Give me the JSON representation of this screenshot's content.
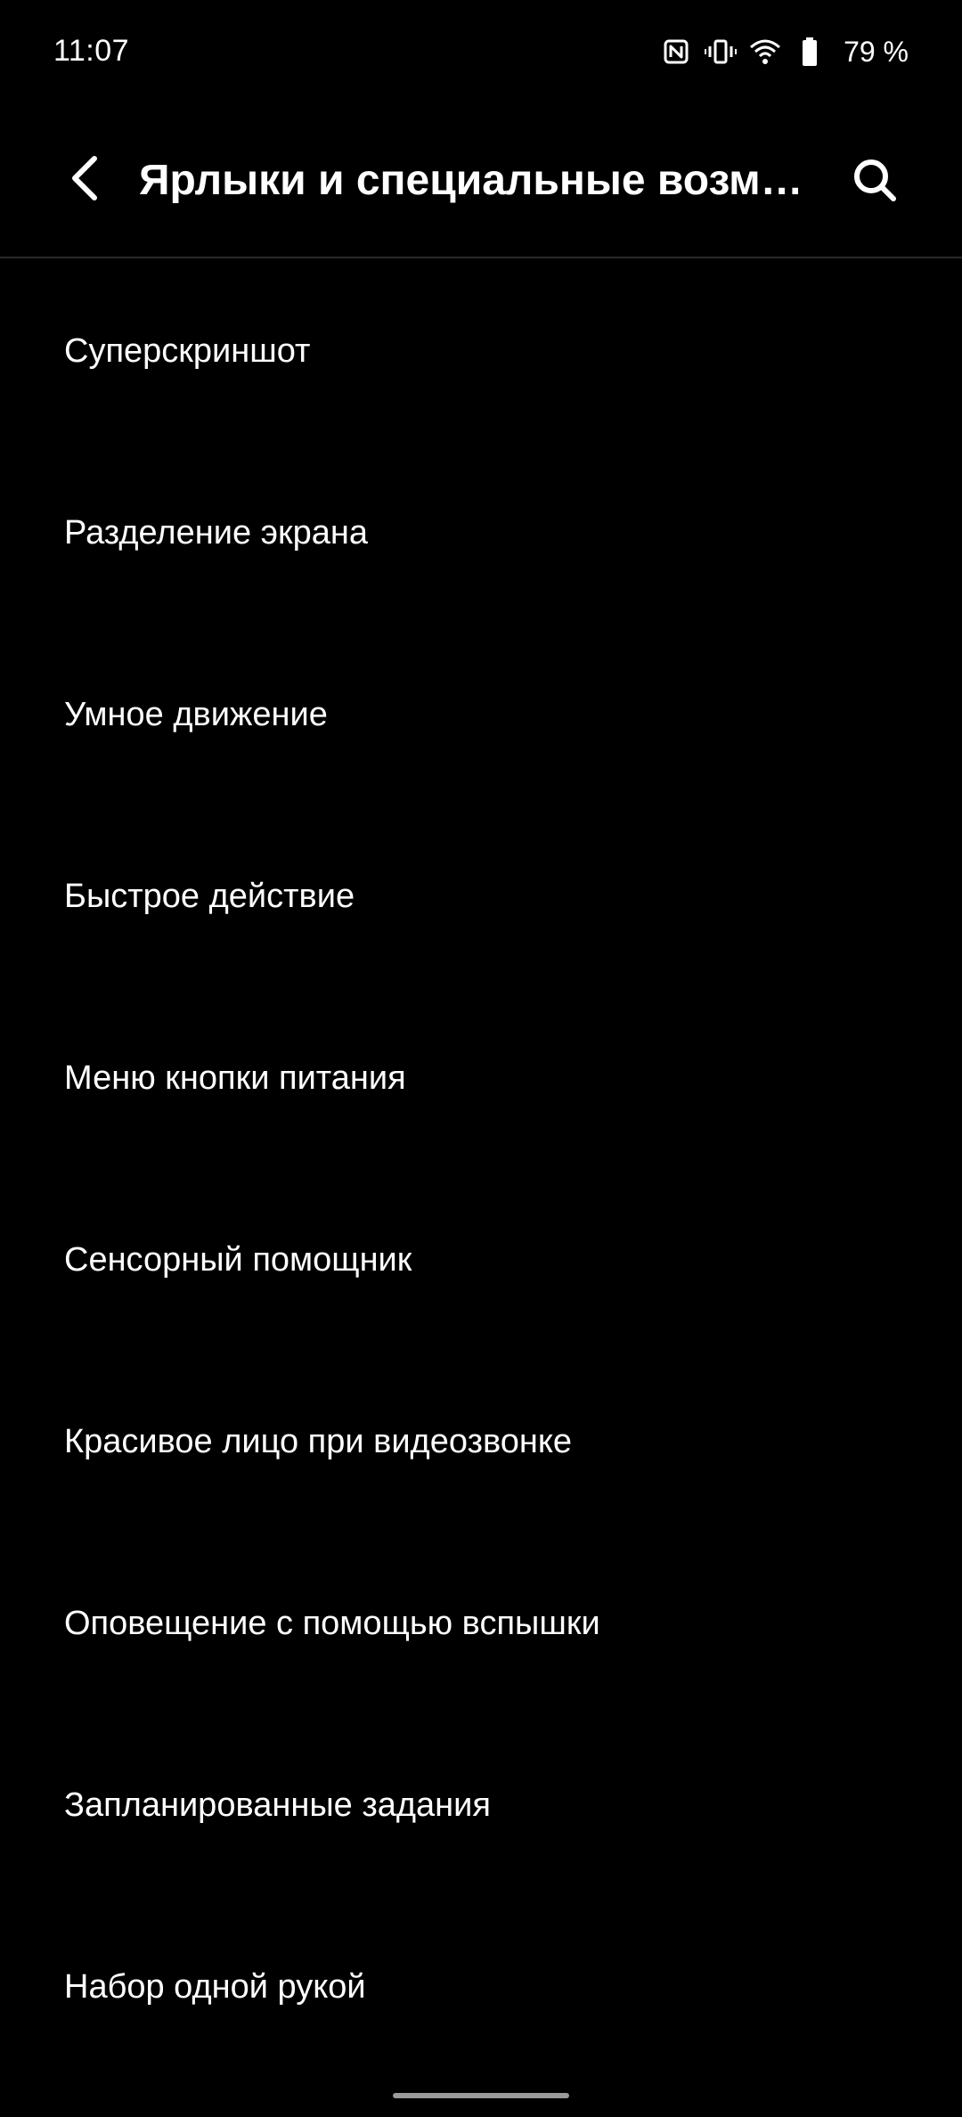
{
  "status_bar": {
    "time": "11:07",
    "icons": [
      "nfc-icon",
      "vibrate-icon",
      "wifi-icon",
      "battery-icon"
    ],
    "battery_percent": "79 %"
  },
  "header": {
    "back_icon": "chevron-left-icon",
    "title": "Ярлыки и специальные возм…",
    "search_icon": "search-icon"
  },
  "settings": {
    "items": [
      {
        "label": "Суперскриншот"
      },
      {
        "label": "Разделение экрана"
      },
      {
        "label": "Умное движение"
      },
      {
        "label": "Быстрое действие"
      },
      {
        "label": "Меню кнопки питания"
      },
      {
        "label": "Сенсорный помощник"
      },
      {
        "label": "Красивое лицо при видеозвонке"
      },
      {
        "label": "Оповещение с помощью вспышки"
      },
      {
        "label": "Запланированные задания"
      },
      {
        "label": "Набор одной рукой"
      }
    ]
  },
  "colors": {
    "background": "#000000",
    "text": "#ffffff",
    "divider": "#2a2a2a"
  }
}
